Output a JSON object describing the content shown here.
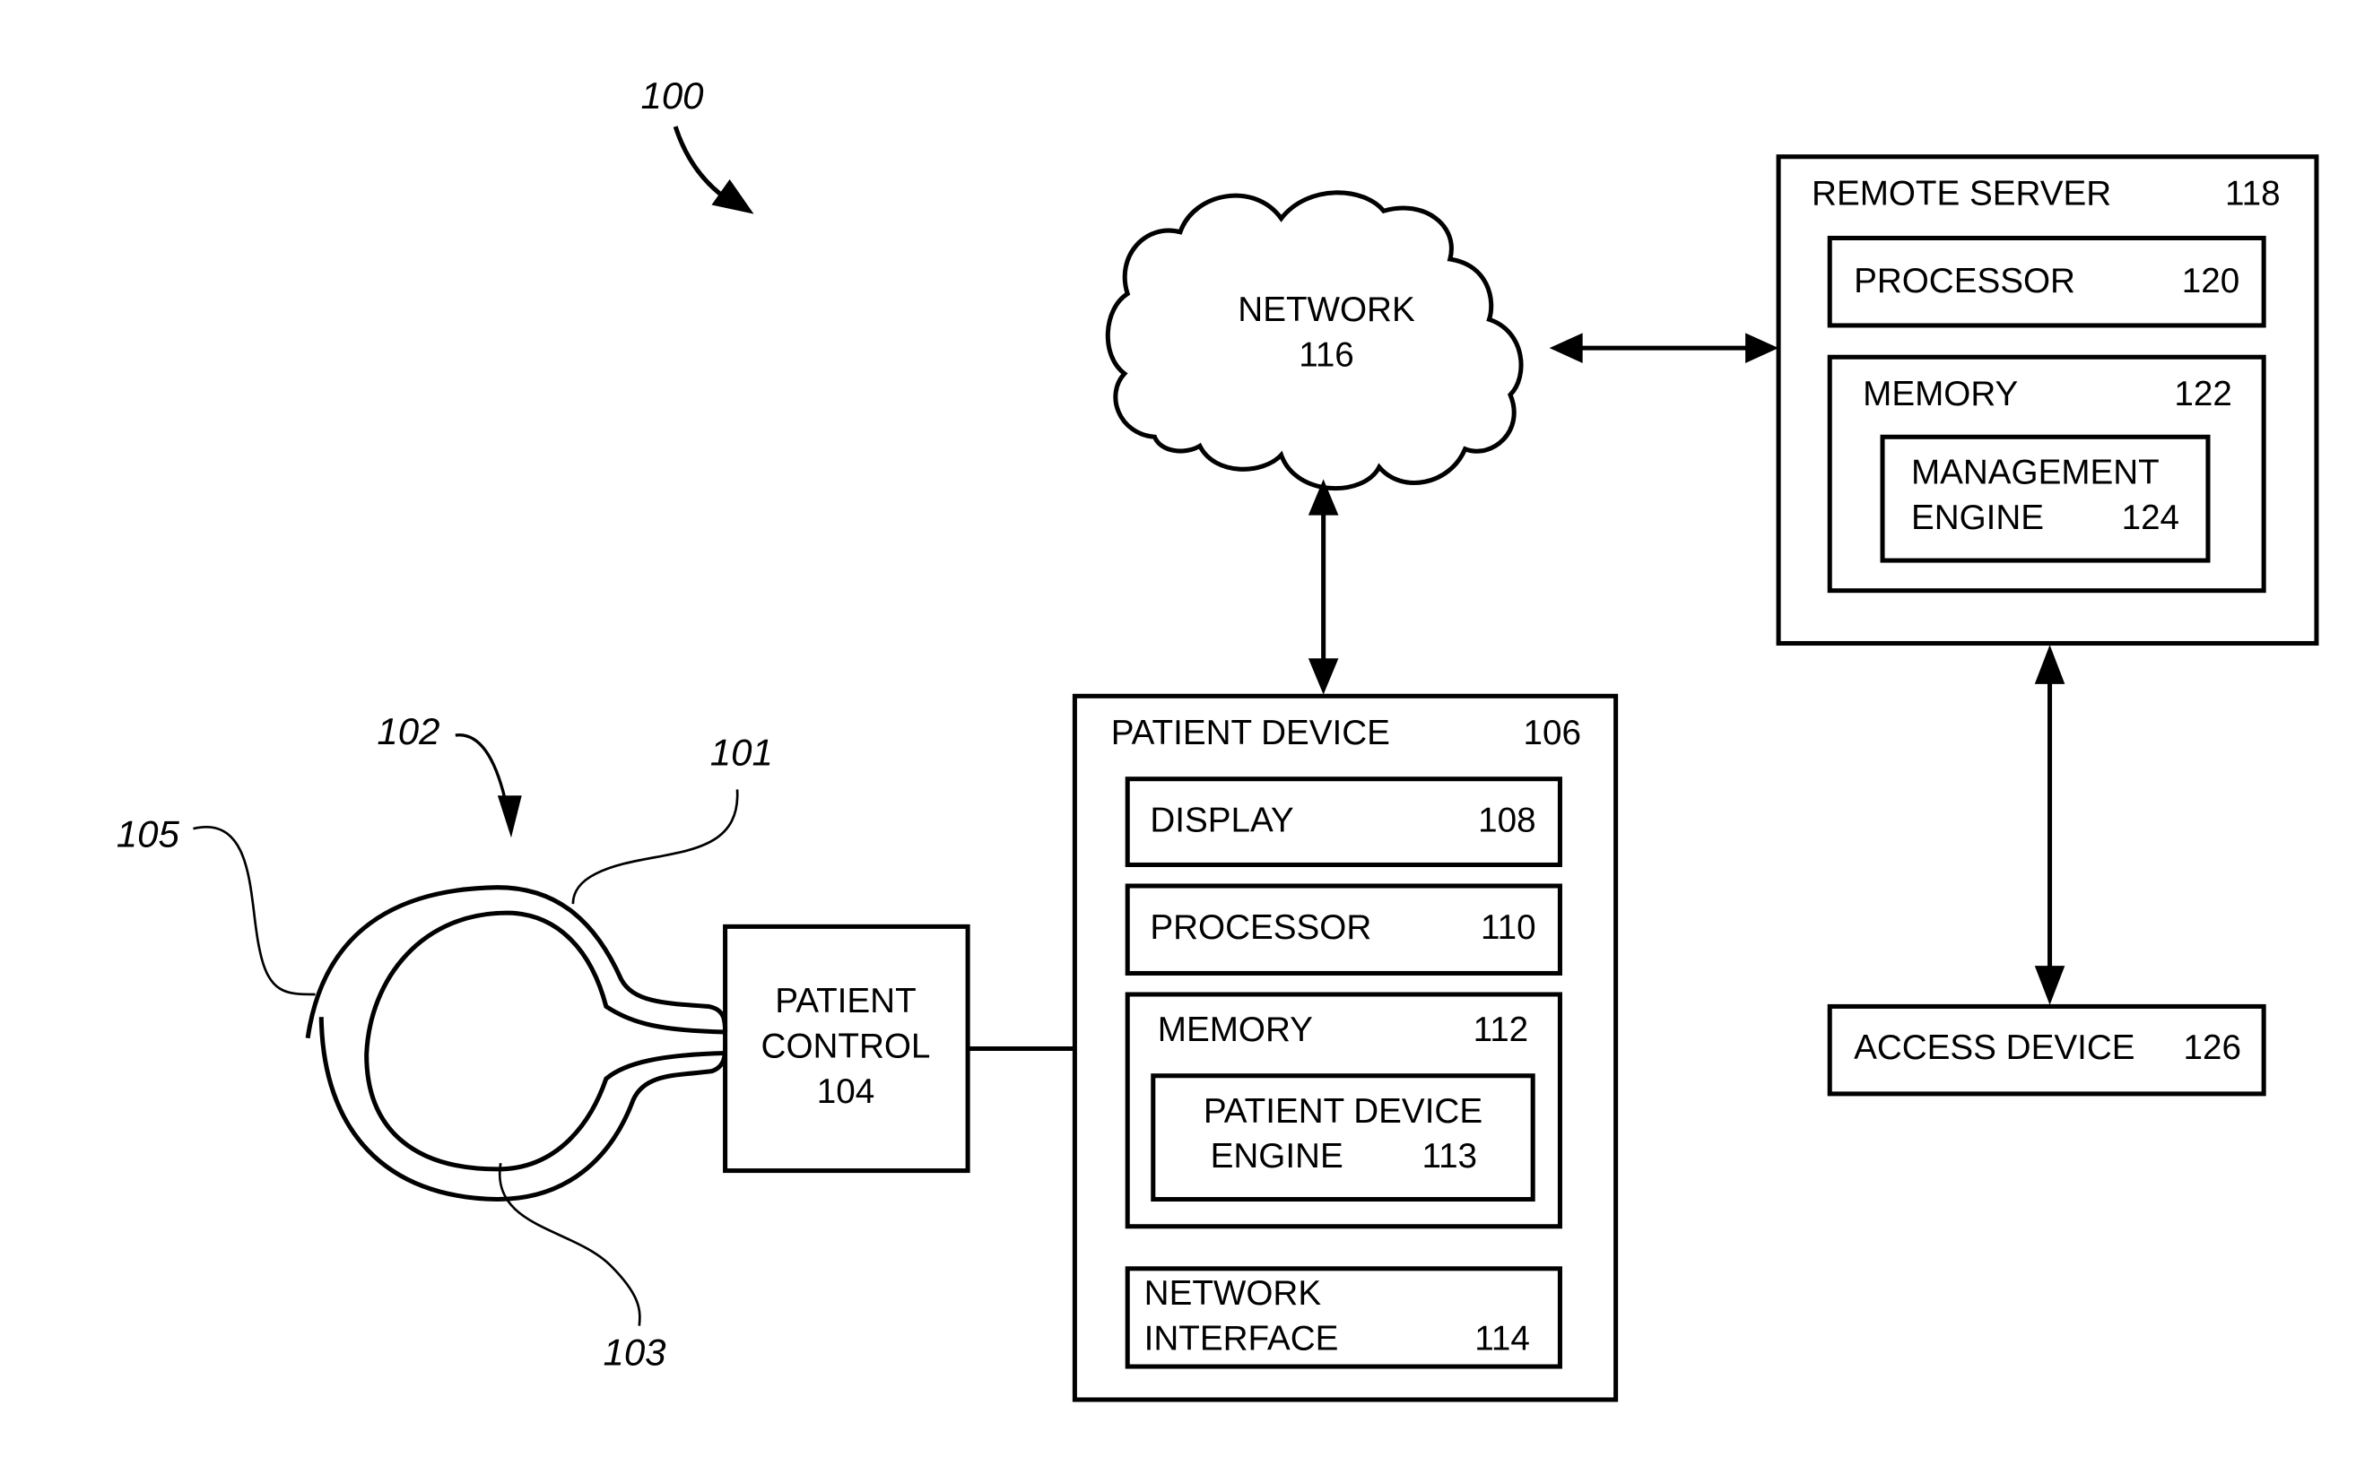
{
  "figure": {
    "reference": "100",
    "colors": {
      "stroke": "#000000",
      "background": "#ffffff"
    }
  },
  "device": {
    "reference": "102",
    "outer_ring_reference": "101",
    "inner_ring_reference": "103",
    "gap_reference": "105"
  },
  "patient_control": {
    "line1": "PATIENT",
    "line2": "CONTROL",
    "number": "104"
  },
  "patient_device": {
    "title": "PATIENT DEVICE",
    "number": "106",
    "display": {
      "label": "DISPLAY",
      "number": "108"
    },
    "processor": {
      "label": "PROCESSOR",
      "number": "110"
    },
    "memory": {
      "label": "MEMORY",
      "number": "112",
      "engine": {
        "line1": "PATIENT DEVICE",
        "line2": "ENGINE",
        "number": "113"
      }
    },
    "network_interface": {
      "line1": "NETWORK",
      "line2": "INTERFACE",
      "number": "114"
    }
  },
  "network": {
    "label": "NETWORK",
    "number": "116"
  },
  "remote_server": {
    "title": "REMOTE SERVER",
    "number": "118",
    "processor": {
      "label": "PROCESSOR",
      "number": "120"
    },
    "memory": {
      "label": "MEMORY",
      "number": "122",
      "engine": {
        "line1": "MANAGEMENT",
        "line2": "ENGINE",
        "number": "124"
      }
    }
  },
  "access_device": {
    "label": "ACCESS DEVICE",
    "number": "126"
  }
}
